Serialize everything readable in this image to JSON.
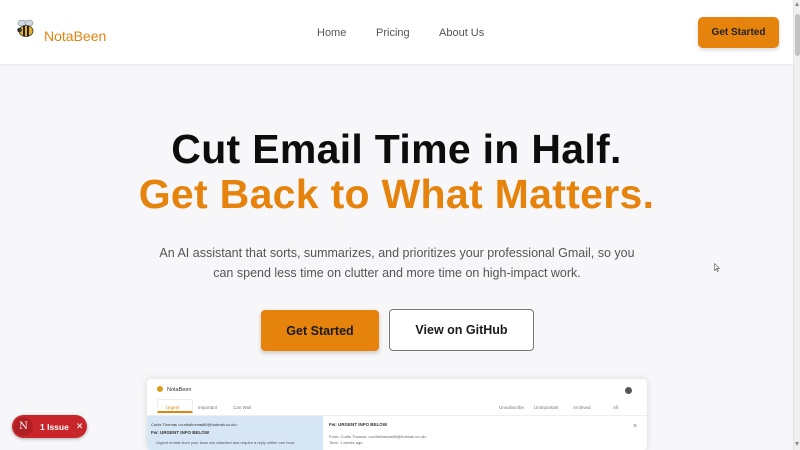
{
  "header": {
    "brand": "NotaBeen",
    "nav": [
      "Home",
      "Pricing",
      "About Us"
    ],
    "cta": "Get Started"
  },
  "hero": {
    "title_line1": "Cut Email Time in Half.",
    "title_line2": "Get Back to What Matters.",
    "subtitle": "An AI assistant that sorts, summarizes, and prioritizes your professional Gmail, so you can spend less time on clutter and more time on high-impact work.",
    "primary_button": "Get Started",
    "secondary_button": "View on GitHub"
  },
  "preview": {
    "app_name": "NotaBeen",
    "tabs": [
      "Urgent",
      "Important",
      "Can Wait"
    ],
    "right_tabs": [
      "Unsubscribe",
      "Unimportant",
      "Archived",
      "All"
    ],
    "list_sender": "Curtis Thomas <curtisthomas89@hotmail.co.uk>",
    "list_subject": "Fw: URGENT INFO BELOW",
    "list_snippet": "Urgent emails from your boss are attached and require a reply within one hour.",
    "detail_subject": "Fw: URGENT INFO BELOW",
    "detail_from": "From: Curtis Thomas <curtisthomas89@hotmail.co.uk>",
    "detail_time": "Time: 1 weeks ago"
  },
  "dev_badge": {
    "icon_letter": "N",
    "label": "1 Issue",
    "close": "✕"
  },
  "colors": {
    "accent": "#e5830d",
    "issue_red": "#c8262b"
  }
}
